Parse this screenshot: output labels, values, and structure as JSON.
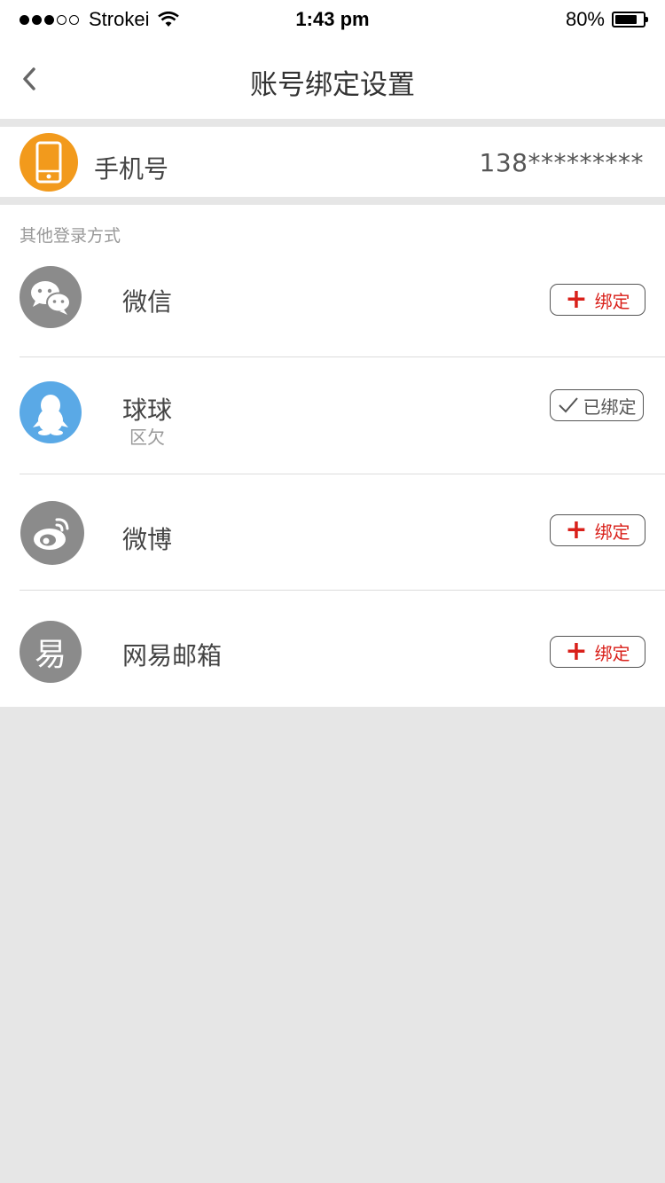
{
  "status_bar": {
    "carrier": "Strokei",
    "time": "1:43 pm",
    "battery": "80%",
    "battery_level": 0.8
  },
  "nav": {
    "title": "账号绑定设置"
  },
  "phone": {
    "label": "手机号",
    "value": "138*********"
  },
  "section_label": "其他登录方式",
  "accounts": [
    {
      "name": "微信",
      "subtitle": "",
      "button": "绑定",
      "bound": false,
      "icon": "wechat-icon"
    },
    {
      "name": "球球",
      "subtitle": "区欠",
      "button": "已绑定",
      "bound": true,
      "icon": "qq-penguin-icon"
    },
    {
      "name": "微博",
      "subtitle": "",
      "button": "绑定",
      "bound": false,
      "icon": "weibo-icon"
    },
    {
      "name": "网易邮箱",
      "subtitle": "",
      "button": "绑定",
      "bound": false,
      "icon": "netease-icon"
    }
  ],
  "avatar_glyph_netease": "易",
  "colors": {
    "accent_red": "#d9201a",
    "phone_orange": "#f29a1c",
    "qq_blue": "#5aa9e6",
    "icon_gray": "#8b8b8b"
  }
}
